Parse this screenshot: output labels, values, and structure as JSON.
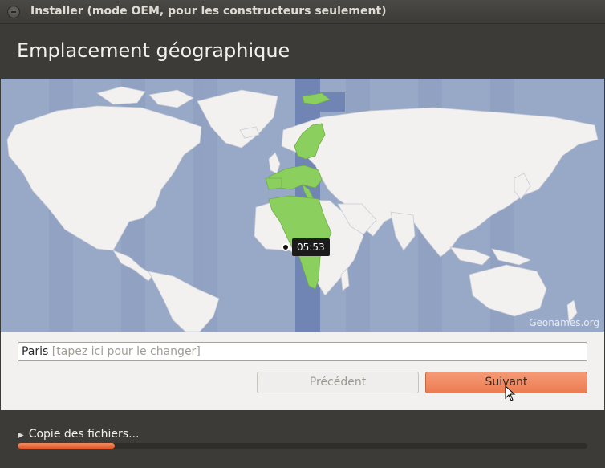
{
  "window": {
    "title": "Installer (mode OEM, pour les constructeurs seulement)"
  },
  "header": {
    "title": "Emplacement géographique"
  },
  "map": {
    "credit": "Geonames.org",
    "selected_city": "Paris",
    "local_time": "05:53",
    "colors": {
      "ocean": "#98a8c7",
      "land": "#f2f1ef",
      "selected_zone": "#7085b4",
      "highlight_land": "#8bd05f"
    }
  },
  "location": {
    "value": "Paris",
    "placeholder": "[tapez ici pour le changer]"
  },
  "buttons": {
    "prev_label": "Précédent",
    "next_label": "Suivant"
  },
  "footer": {
    "copy_label": "Copie des fichiers...",
    "progress_fraction": 0.17
  },
  "accent_color": "#ec7c52"
}
